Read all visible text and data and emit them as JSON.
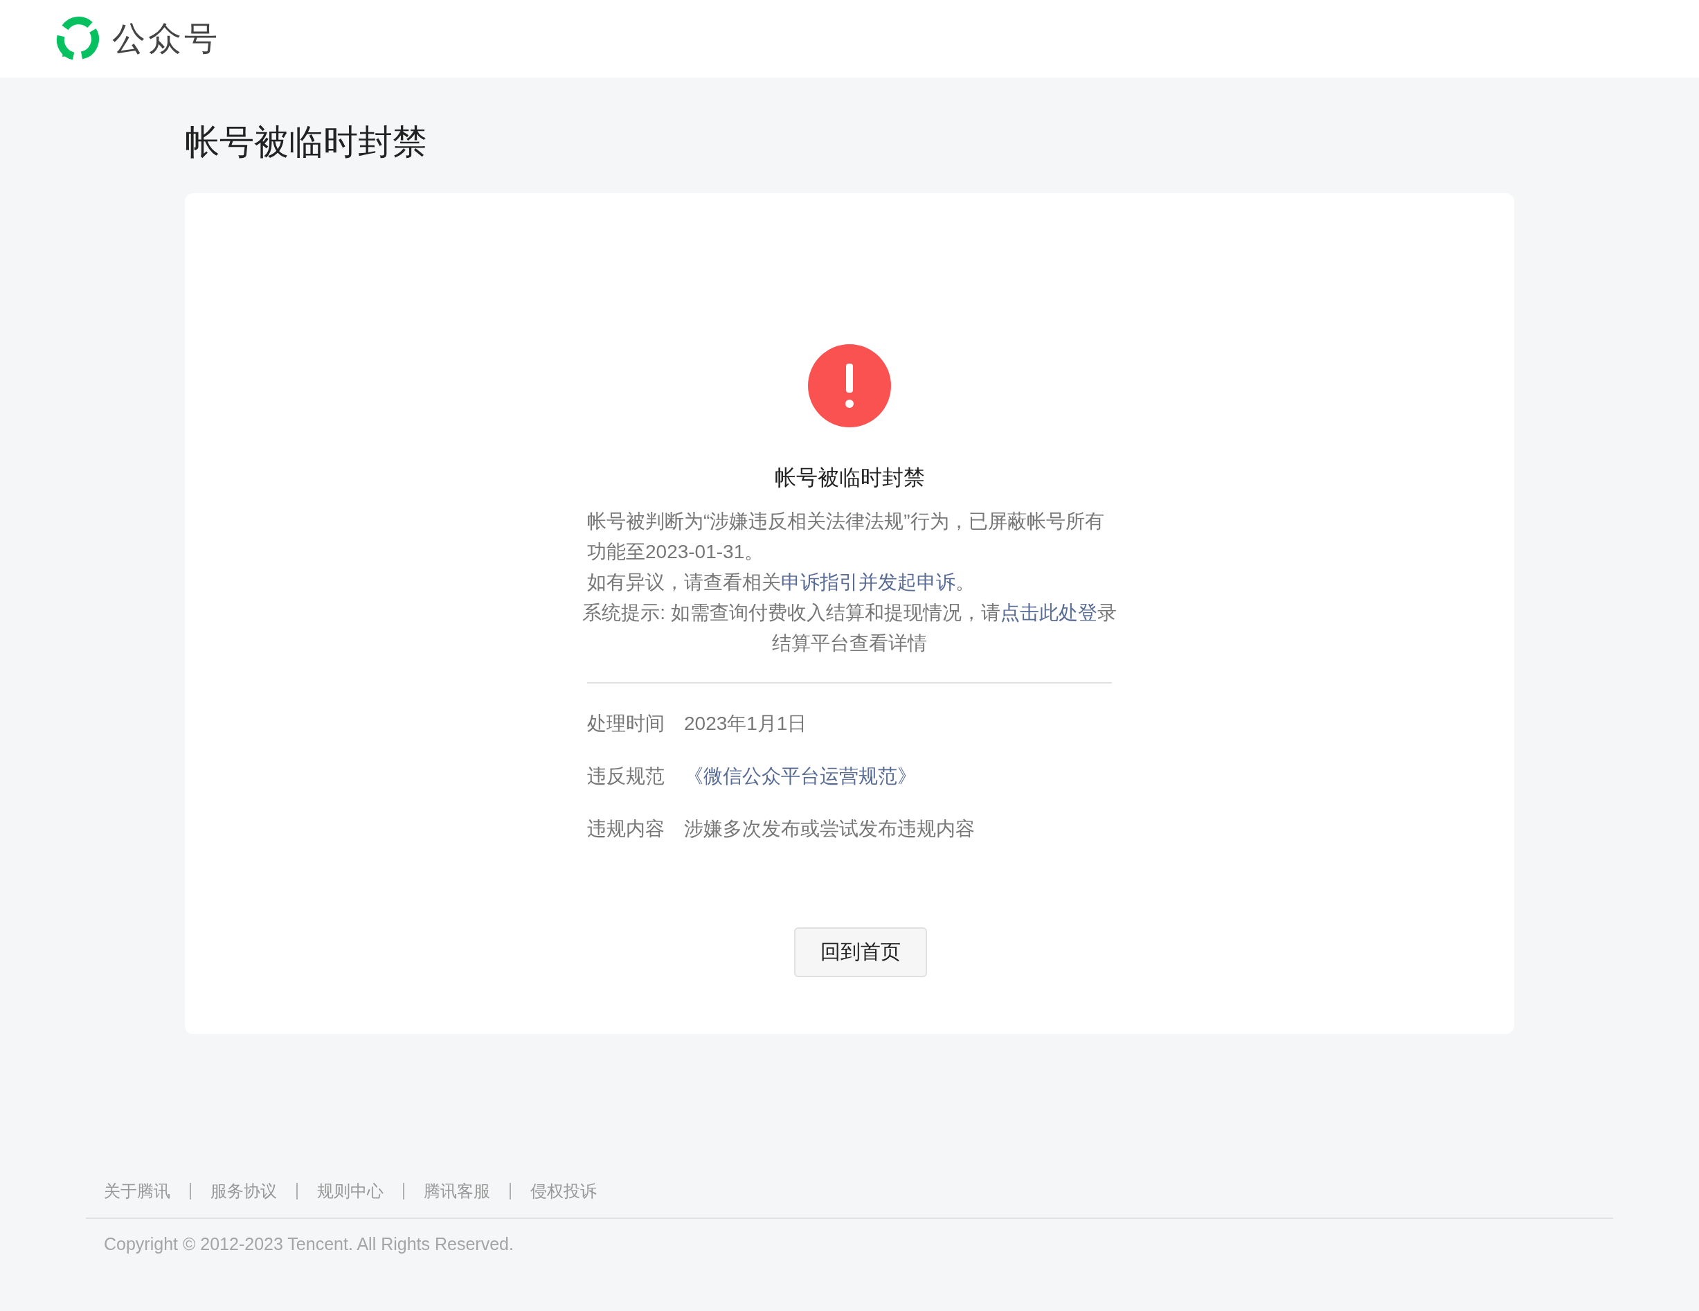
{
  "header": {
    "brand": "公众号"
  },
  "page_title": "帐号被临时封禁",
  "notice": {
    "heading": "帐号被临时封禁",
    "paragraphs": [
      {
        "kind": "body",
        "segments": [
          {
            "text": "帐号被判断为“涉嫌违反相关法律法规”行为，已屏蔽帐号所有功能至2023-01-31。",
            "link": false
          }
        ]
      },
      {
        "kind": "body",
        "segments": [
          {
            "text": "如有异议，请查看相关",
            "link": false
          },
          {
            "text": "申诉指引并发起申诉",
            "link": true
          },
          {
            "text": "。",
            "link": false
          }
        ]
      },
      {
        "kind": "tip",
        "segments": [
          {
            "text": "系统提示: 如需查询付费收入结算和提现情况，请",
            "link": false
          },
          {
            "text": "点击此处登",
            "link": true
          },
          {
            "text": "录结算平台查看详情",
            "link": false
          }
        ]
      }
    ],
    "details": [
      {
        "label": "处理时间",
        "value": "2023年1月1日",
        "link": false
      },
      {
        "label": "违反规范",
        "value": "《微信公众平台运营规范》",
        "link": true
      },
      {
        "label": "违规内容",
        "value": "涉嫌多次发布或尝试发布违规内容",
        "link": false
      }
    ],
    "button": "回到首页"
  },
  "footer": {
    "links": [
      "关于腾讯",
      "服务协议",
      "规则中心",
      "腾讯客服",
      "侵权投诉"
    ],
    "copyright": "Copyright © 2012-2023 Tencent. All Rights Reserved."
  }
}
